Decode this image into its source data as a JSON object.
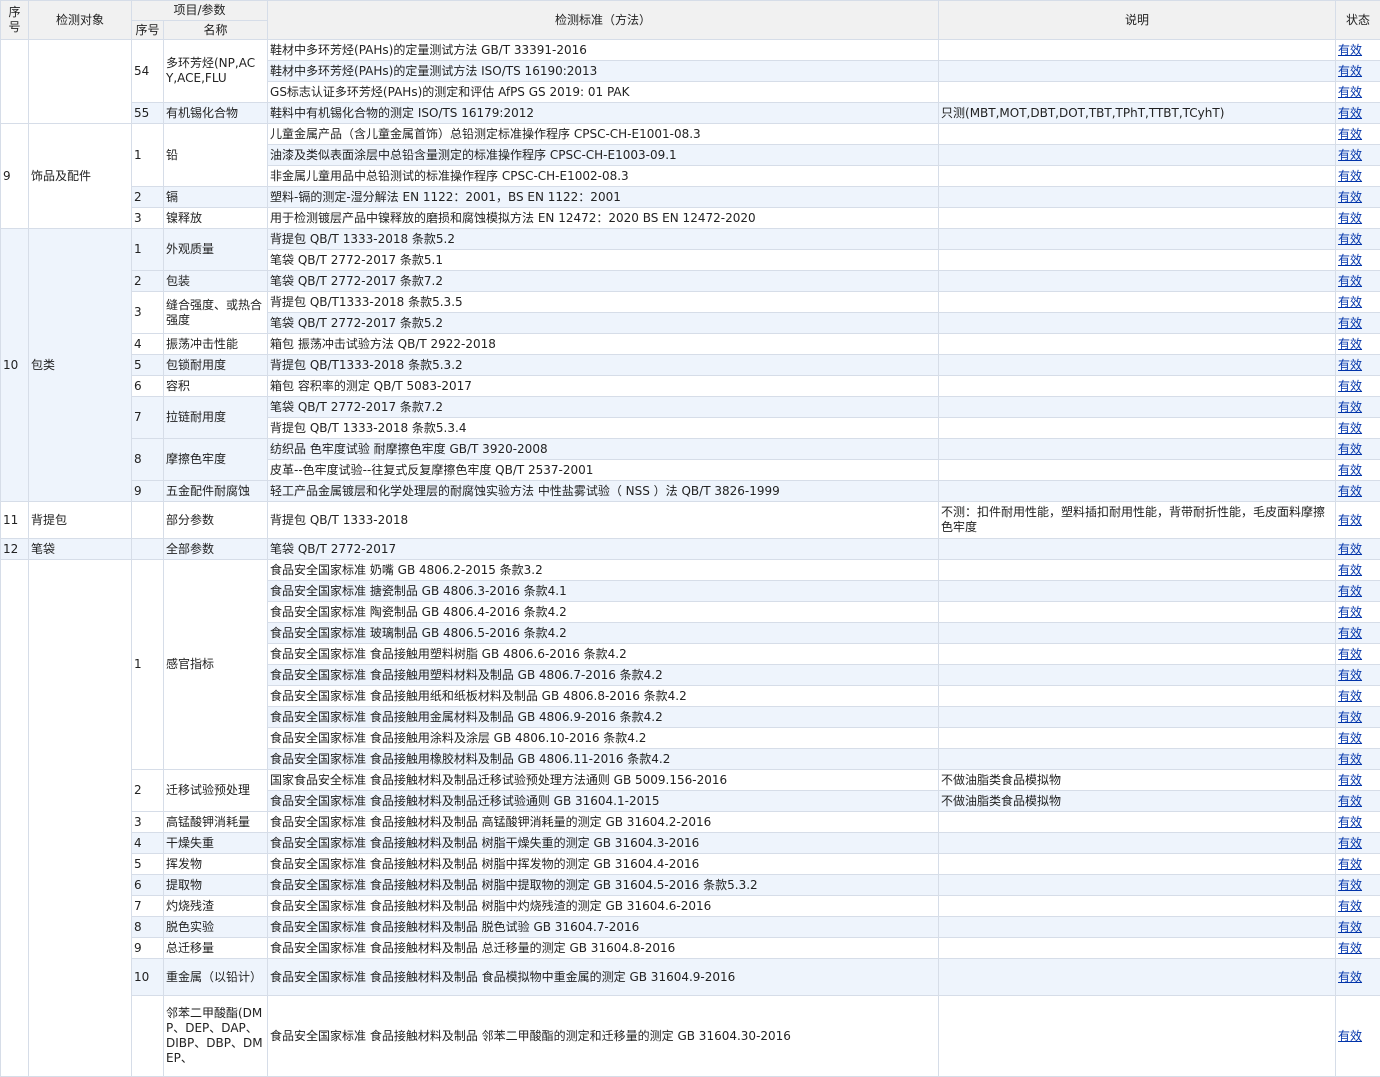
{
  "header": {
    "seq": "序号",
    "object": "检测对象",
    "item_group": "项目/参数",
    "item_seq": "序号",
    "item_name": "名称",
    "standard": "检测标准（方法）",
    "note": "说明",
    "status": "状态"
  },
  "status_text": "有效",
  "groups": [
    {
      "seq": "",
      "object": "",
      "items": [
        {
          "seq": "54",
          "name": "多环芳烃(NP,ACY,ACE,FLU",
          "rows": [
            {
              "std": "鞋材中多环芳烃(PAHs)的定量测试方法 GB/T 33391-2016",
              "note": ""
            },
            {
              "std": "鞋材中多环芳烃(PAHs)的定量测试方法 ISO/TS 16190:2013",
              "note": ""
            },
            {
              "std": "GS标志认证多环芳烃(PAHs)的测定和评估 AfPS GS 2019: 01 PAK",
              "note": ""
            }
          ]
        },
        {
          "seq": "55",
          "name": "有机锡化合物",
          "rows": [
            {
              "std": "鞋料中有机锡化合物的测定 ISO/TS 16179:2012",
              "note": "只测(MBT,MOT,DBT,DOT,TBT,TPhT,TTBT,TCyhT)"
            }
          ]
        }
      ]
    },
    {
      "seq": "9",
      "object": "饰品及配件",
      "items": [
        {
          "seq": "1",
          "name": "铅",
          "rows": [
            {
              "std": "儿童金属产品（含儿童金属首饰）总铅测定标准操作程序 CPSC-CH-E1001-08.3",
              "note": ""
            },
            {
              "std": "油漆及类似表面涂层中总铅含量测定的标准操作程序 CPSC-CH-E1003-09.1",
              "note": ""
            },
            {
              "std": "非金属儿童用品中总铅测试的标准操作程序 CPSC-CH-E1002-08.3",
              "note": ""
            }
          ]
        },
        {
          "seq": "2",
          "name": "镉",
          "rows": [
            {
              "std": "塑料-镉的测定-湿分解法 EN 1122：2001，BS EN 1122：2001",
              "note": ""
            }
          ]
        },
        {
          "seq": "3",
          "name": "镍释放",
          "rows": [
            {
              "std": "用于检测镀层产品中镍释放的磨损和腐蚀模拟方法 EN 12472：2020 BS EN 12472-2020",
              "note": ""
            }
          ]
        }
      ]
    },
    {
      "seq": "10",
      "object": "包类",
      "items": [
        {
          "seq": "1",
          "name": "外观质量",
          "rows": [
            {
              "std": "背提包 QB/T 1333-2018 条款5.2",
              "note": ""
            },
            {
              "std": "笔袋 QB/T 2772-2017 条款5.1",
              "note": ""
            }
          ]
        },
        {
          "seq": "2",
          "name": "包装",
          "rows": [
            {
              "std": "笔袋 QB/T 2772-2017 条款7.2",
              "note": ""
            }
          ]
        },
        {
          "seq": "3",
          "name": "缝合强度、或热合强度",
          "rows": [
            {
              "std": "背提包 QB/T1333-2018 条款5.3.5",
              "note": ""
            },
            {
              "std": "笔袋 QB/T 2772-2017 条款5.2",
              "note": ""
            }
          ]
        },
        {
          "seq": "4",
          "name": "振荡冲击性能",
          "rows": [
            {
              "std": "箱包 振荡冲击试验方法 QB/T 2922-2018",
              "note": ""
            }
          ]
        },
        {
          "seq": "5",
          "name": "包锁耐用度",
          "rows": [
            {
              "std": "背提包 QB/T1333-2018 条款5.3.2",
              "note": ""
            }
          ]
        },
        {
          "seq": "6",
          "name": "容积",
          "rows": [
            {
              "std": "箱包 容积率的测定 QB/T 5083-2017",
              "note": ""
            }
          ]
        },
        {
          "seq": "7",
          "name": "拉链耐用度",
          "rows": [
            {
              "std": "笔袋 QB/T 2772-2017 条款7.2",
              "note": ""
            },
            {
              "std": "背提包 QB/T 1333-2018 条款5.3.4",
              "note": ""
            }
          ]
        },
        {
          "seq": "8",
          "name": "摩擦色牢度",
          "rows": [
            {
              "std": "纺织品 色牢度试验 耐摩擦色牢度 GB/T 3920-2008",
              "note": ""
            },
            {
              "std": "皮革--色牢度试验--往复式反复摩擦色牢度 QB/T 2537-2001",
              "note": ""
            }
          ]
        },
        {
          "seq": "9",
          "name": "五金配件耐腐蚀",
          "rows": [
            {
              "std": "轻工产品金属镀层和化学处理层的耐腐蚀实验方法 中性盐雾试验（ NSS ）法 QB/T 3826-1999",
              "note": ""
            }
          ]
        }
      ]
    },
    {
      "seq": "11",
      "object": "背提包",
      "items": [
        {
          "seq": "",
          "name": "部分参数",
          "rows": [
            {
              "std": "背提包 QB/T 1333-2018",
              "note": "不测：扣件耐用性能，塑料插扣耐用性能，背带耐折性能，毛皮面料摩擦色牢度"
            }
          ]
        }
      ]
    },
    {
      "seq": "12",
      "object": "笔袋",
      "items": [
        {
          "seq": "",
          "name": "全部参数",
          "rows": [
            {
              "std": "笔袋 QB/T 2772-2017",
              "note": ""
            }
          ]
        }
      ]
    },
    {
      "seq": "",
      "object": "",
      "items": [
        {
          "seq": "1",
          "name": "感官指标",
          "rows": [
            {
              "std": "食品安全国家标准 奶嘴 GB 4806.2-2015 条款3.2",
              "note": ""
            },
            {
              "std": "食品安全国家标准 搪瓷制品 GB 4806.3-2016 条款4.1",
              "note": ""
            },
            {
              "std": "食品安全国家标准 陶瓷制品 GB 4806.4-2016 条款4.2",
              "note": ""
            },
            {
              "std": "食品安全国家标准 玻璃制品 GB 4806.5-2016 条款4.2",
              "note": ""
            },
            {
              "std": "食品安全国家标准 食品接触用塑料树脂 GB 4806.6-2016 条款4.2",
              "note": ""
            },
            {
              "std": "食品安全国家标准 食品接触用塑料材料及制品 GB 4806.7-2016 条款4.2",
              "note": ""
            },
            {
              "std": "食品安全国家标准 食品接触用纸和纸板材料及制品 GB 4806.8-2016 条款4.2",
              "note": ""
            },
            {
              "std": "食品安全国家标准 食品接触用金属材料及制品 GB 4806.9-2016 条款4.2",
              "note": ""
            },
            {
              "std": "食品安全国家标准 食品接触用涂料及涂层 GB 4806.10-2016 条款4.2",
              "note": ""
            },
            {
              "std": "食品安全国家标准 食品接触用橡胶材料及制品 GB 4806.11-2016 条款4.2",
              "note": ""
            }
          ]
        },
        {
          "seq": "2",
          "name": "迁移试验预处理",
          "rows": [
            {
              "std": "国家食品安全标准 食品接触材料及制品迁移试验预处理方法通则 GB 5009.156-2016",
              "note": "不做油脂类食品模拟物"
            },
            {
              "std": "食品安全国家标准 食品接触材料及制品迁移试验通则 GB 31604.1-2015",
              "note": "不做油脂类食品模拟物"
            }
          ]
        },
        {
          "seq": "3",
          "name": "高锰酸钾消耗量",
          "rows": [
            {
              "std": "食品安全国家标准 食品接触材料及制品 高锰酸钾消耗量的测定 GB 31604.2-2016",
              "note": ""
            }
          ]
        },
        {
          "seq": "4",
          "name": "干燥失重",
          "rows": [
            {
              "std": "食品安全国家标准 食品接触材料及制品 树脂干燥失重的测定 GB 31604.3-2016",
              "note": ""
            }
          ]
        },
        {
          "seq": "5",
          "name": "挥发物",
          "rows": [
            {
              "std": "食品安全国家标准 食品接触材料及制品 树脂中挥发物的测定 GB 31604.4-2016",
              "note": ""
            }
          ]
        },
        {
          "seq": "6",
          "name": "提取物",
          "rows": [
            {
              "std": "食品安全国家标准 食品接触材料及制品 树脂中提取物的测定 GB 31604.5-2016 条款5.3.2",
              "note": ""
            }
          ]
        },
        {
          "seq": "7",
          "name": "灼烧残渣",
          "rows": [
            {
              "std": "食品安全国家标准 食品接触材料及制品 树脂中灼烧残渣的测定 GB 31604.6-2016",
              "note": ""
            }
          ]
        },
        {
          "seq": "8",
          "name": "脱色实验",
          "rows": [
            {
              "std": "食品安全国家标准 食品接触材料及制品 脱色试验 GB 31604.7-2016",
              "note": ""
            }
          ]
        },
        {
          "seq": "9",
          "name": "总迁移量",
          "rows": [
            {
              "std": "食品安全国家标准 食品接触材料及制品 总迁移量的测定 GB 31604.8-2016",
              "note": ""
            }
          ]
        },
        {
          "seq": "10",
          "name": "重金属（以铅计）",
          "rows": [
            {
              "std": "食品安全国家标准 食品接触材料及制品 食品模拟物中重金属的测定 GB 31604.9-2016",
              "note": ""
            }
          ]
        },
        {
          "seq": "",
          "name": "邻苯二甲酸酯(DMP、DEP、DAP、DIBP、DBP、DMEP、",
          "rows": [
            {
              "std": "食品安全国家标准 食品接触材料及制品 邻苯二甲酸酯的测定和迁移量的测定 GB 31604.30-2016",
              "note": ""
            }
          ]
        }
      ]
    }
  ]
}
